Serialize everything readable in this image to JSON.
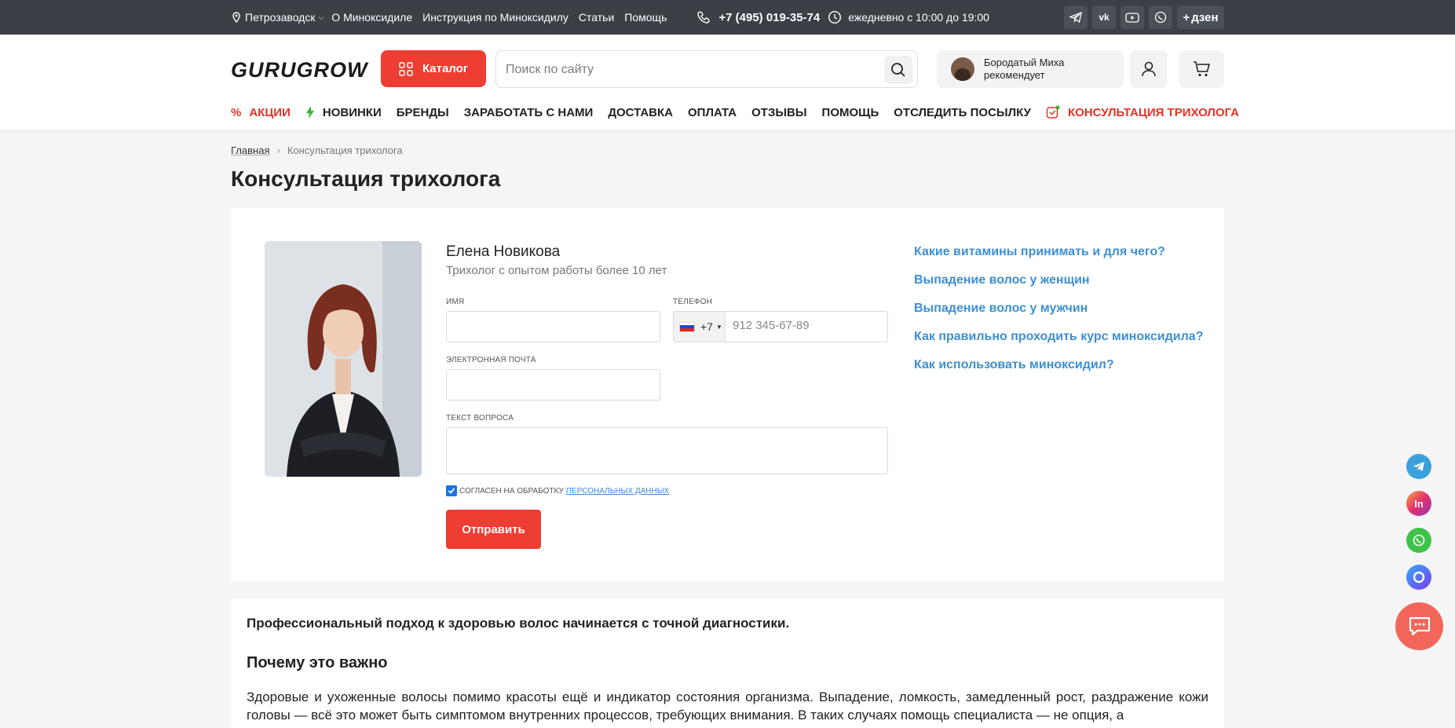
{
  "topbar": {
    "city": "Петрозаводск",
    "links": [
      "О Миноксидиле",
      "Инструкция по Миноксидилу",
      "Статьи",
      "Помощь"
    ],
    "phone": "+7 (495) 019-35-74",
    "hours": "ежедневно с 10:00 до 19:00",
    "social": [
      "telegram-icon",
      "vk-icon",
      "youtube-icon",
      "whatsapp-icon"
    ],
    "dzen_label": "дзен"
  },
  "header": {
    "logo": "GURUGROW",
    "catalog_label": "Каталог",
    "search_placeholder": "Поиск по сайту",
    "recommend": {
      "line1": "Бородатый Миха",
      "line2": "рекомендует"
    }
  },
  "nav": [
    {
      "label": "АКЦИИ",
      "icon": "percent-icon",
      "accent": true
    },
    {
      "label": "НОВИНКИ",
      "icon": "lightning-icon",
      "accent": false
    },
    {
      "label": "БРЕНДЫ",
      "accent": false
    },
    {
      "label": "ЗАРАБОТАТЬ С НАМИ",
      "accent": false
    },
    {
      "label": "ДОСТАВКА",
      "accent": false
    },
    {
      "label": "ОПЛАТА",
      "accent": false
    },
    {
      "label": "ОТЗЫВЫ",
      "accent": false
    },
    {
      "label": "ПОМОЩЬ",
      "accent": false
    },
    {
      "label": "ОТСЛЕДИТЬ ПОСЫЛКУ",
      "accent": false
    },
    {
      "label": "КОНСУЛЬТАЦИЯ ТРИХОЛОГА",
      "icon": "consult-icon",
      "accent": true
    }
  ],
  "breadcrumb": {
    "home": "Главная",
    "sep": "›",
    "current": "Консультация трихолога"
  },
  "page_title": "Консультация трихолога",
  "consult": {
    "name": "Елена Новикова",
    "subtitle": "Трихолог с опытом работы более 10 лет",
    "labels": {
      "name": "Имя",
      "phone": "Телефон",
      "email": "Электронная почта",
      "question": "Текст вопроса"
    },
    "values": {
      "name": "",
      "email": "",
      "question": ""
    },
    "phone_code": "+7",
    "phone_placeholder": "912 345-67-89",
    "consent_text": "СОГЛАСЕН НА ОБРАБОТКУ",
    "consent_link": "ПЕРСОНАЛЬНЫХ ДАННЫХ",
    "consent_checked": true,
    "submit_label": "Отправить"
  },
  "faq": [
    "Какие витамины принимать и для чего?",
    "Выпадение волос у женщин",
    "Выпадение волос у мужчин",
    "Как правильно проходить курс миноксидила?",
    "Как использовать миноксидил?"
  ],
  "article": {
    "lead": "Профессиональный подход к здоровью волос начинается с точной диагностики.",
    "heading": "Почему это важно",
    "paragraph": "Здоровые и ухоженные волосы помимо красоты ещё и индикатор состояния организма. Выпадение, ломкость, замедленный рост, раздражение кожи головы — всё это может быть симптомом внутренних процессов, требующих внимания. В таких случаях помощь специалиста — не опция, а"
  },
  "floating": [
    "telegram-icon",
    "instagram-icon",
    "whatsapp-icon",
    "max-icon"
  ],
  "colors": {
    "accent": "#ee3d32",
    "link": "#3d8fd3",
    "topbar": "#3b4046"
  }
}
